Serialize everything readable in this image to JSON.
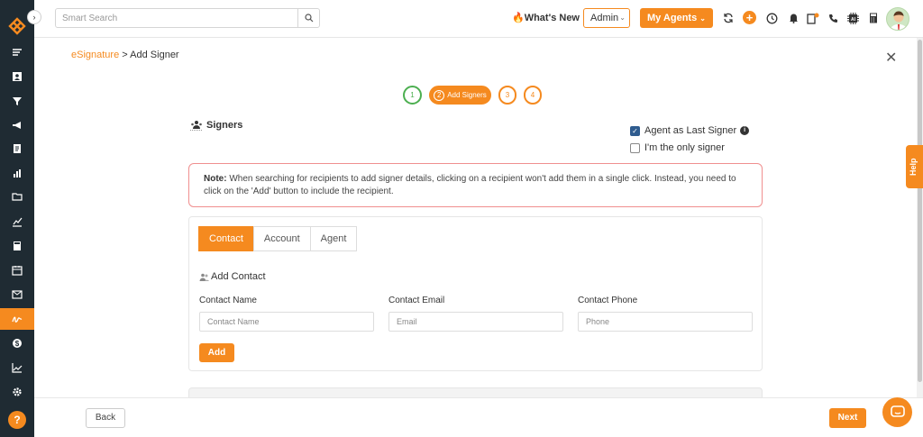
{
  "colors": {
    "accent": "#f58a1f",
    "sidebar": "#1f2b33",
    "success": "#4caf50",
    "note_border": "#f08f8f"
  },
  "sidebar": {
    "items": [
      {
        "icon": "menu-lines-icon"
      },
      {
        "icon": "contact-card-icon"
      },
      {
        "icon": "funnel-icon"
      },
      {
        "icon": "megaphone-icon"
      },
      {
        "icon": "document-icon"
      },
      {
        "icon": "bar-chart-icon"
      },
      {
        "icon": "folder-icon"
      },
      {
        "icon": "analytics-icon"
      },
      {
        "icon": "calculator-icon"
      },
      {
        "icon": "calendar-icon"
      },
      {
        "icon": "mail-icon"
      },
      {
        "icon": "esignature-icon",
        "active": true
      },
      {
        "icon": "dollar-icon"
      },
      {
        "icon": "trend-line-icon"
      },
      {
        "icon": "settings-icon"
      }
    ],
    "help_label": "?"
  },
  "topbar": {
    "search_placeholder": "Smart Search",
    "whats_new": "What's New",
    "role_select": "Admin",
    "my_agents": "My Agents"
  },
  "breadcrumb": {
    "parent": "eSignature",
    "separator": ">",
    "current": "Add Signer"
  },
  "steps": [
    {
      "number": "1",
      "status": "done"
    },
    {
      "number": "2",
      "label": "Add Signers",
      "status": "active"
    },
    {
      "number": "3",
      "status": "pending"
    },
    {
      "number": "4",
      "status": "pending"
    }
  ],
  "signers": {
    "title": "Signers",
    "agent_last_signer": "Agent as Last Signer",
    "only_signer": "I'm the only signer"
  },
  "note": {
    "label": "Note:",
    "text": " When searching for recipients to add signer details, clicking on a recipient won't add them in a single click. Instead, you need to click on the 'Add' button to include the recipient."
  },
  "tabs": [
    "Contact",
    "Account",
    "Agent"
  ],
  "form": {
    "section_title": "Add Contact",
    "name_label": "Contact Name",
    "name_placeholder": "Contact Name",
    "email_label": "Contact Email",
    "email_placeholder": "Email",
    "phone_label": "Contact Phone",
    "phone_placeholder": "Phone",
    "add_button": "Add"
  },
  "footer": {
    "back": "Back",
    "next": "Next"
  },
  "help_tab": "Help"
}
